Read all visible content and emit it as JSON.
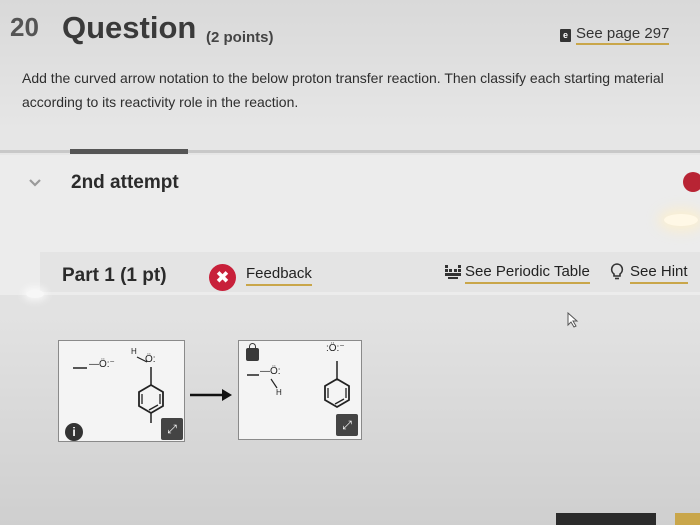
{
  "question": {
    "number": "20",
    "title": "Question",
    "points": "(2 points)",
    "see_page": "See page 297",
    "ebook_icon": "ebook-icon",
    "text": "Add the curved arrow notation to the below proton transfer reaction. Then classify each starting material according to its reactivity role in the reaction."
  },
  "attempt": {
    "label": "2nd attempt",
    "toggle_icon": "chevron-down-icon"
  },
  "part": {
    "title": "Part 1 (1 pt)",
    "feedback_label": "Feedback",
    "periodic_table_label": "See Periodic Table",
    "hint_label": "See Hint"
  },
  "molecules": {
    "hydroxide_label": "—Ö:⁻",
    "phenol_h": "H",
    "phenol_o": "Ö:",
    "water_label": "—Ö:",
    "water_h": "H",
    "phenoxide_label": ":Ö:⁻"
  },
  "colors": {
    "accent_underline": "#c9a64a",
    "error_red": "#c8203a",
    "background": "#e2e2e2"
  }
}
